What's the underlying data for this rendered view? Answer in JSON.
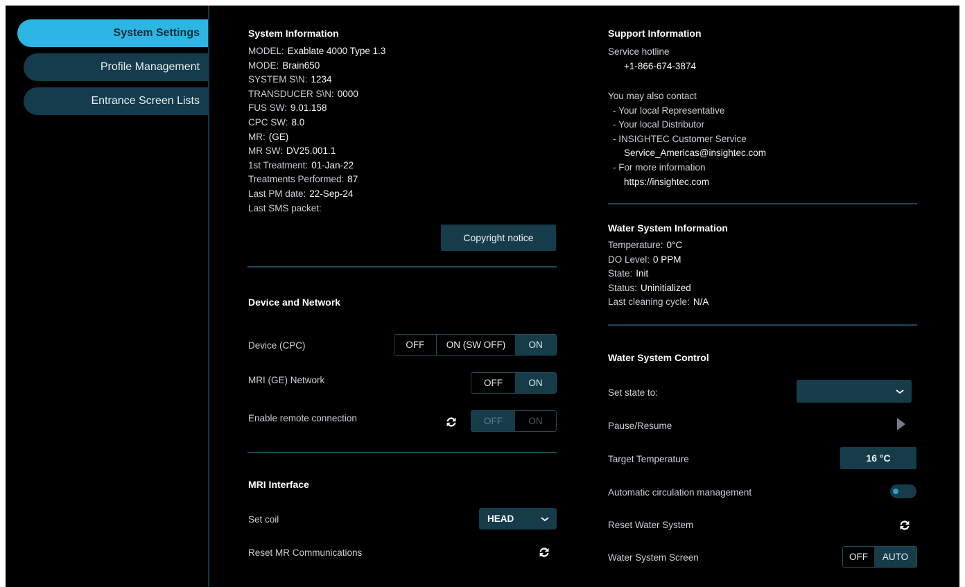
{
  "sidebar": {
    "items": [
      {
        "label": "System Settings"
      },
      {
        "label": "Profile Management"
      },
      {
        "label": "Entrance Screen Lists"
      }
    ]
  },
  "system_info": {
    "title": "System Information",
    "rows": [
      {
        "label": "MODEL:",
        "value": "Exablate 4000 Type 1.3"
      },
      {
        "label": "MODE:",
        "value": "Brain650"
      },
      {
        "label": "SYSTEM S\\N:",
        "value": "1234"
      },
      {
        "label": "TRANSDUCER S\\N:",
        "value": "0000"
      },
      {
        "label": "FUS SW:",
        "value": "9.01.158"
      },
      {
        "label": "CPC SW:",
        "value": "8.0"
      },
      {
        "label": "MR:",
        "value": "(GE)"
      },
      {
        "label": "MR SW:",
        "value": "DV25.001.1"
      },
      {
        "label": "1st Treatment:",
        "value": "01-Jan-22"
      },
      {
        "label": "Treatments Performed:",
        "value": "87"
      },
      {
        "label": "Last PM date:",
        "value": "22-Sep-24"
      },
      {
        "label": "Last SMS packet:",
        "value": ""
      }
    ],
    "copyright_button": "Copyright notice"
  },
  "device_network": {
    "title": "Device and Network",
    "device_label": "Device (CPC)",
    "device_options": [
      "OFF",
      "ON (SW OFF)",
      "ON"
    ],
    "mri_label": "MRI (GE) Network",
    "mri_options": [
      "OFF",
      "ON"
    ],
    "remote_label": "Enable remote connection",
    "remote_options": [
      "OFF",
      "ON"
    ]
  },
  "mri_interface": {
    "title": "MRI Interface",
    "coil_label": "Set coil",
    "coil_value": "HEAD",
    "reset_label": "Reset MR Communications"
  },
  "support": {
    "title": "Support Information",
    "hotline_label": "Service hotline",
    "hotline": "+1-866-674-3874",
    "contact_intro": "You may also contact",
    "contact_1": "- Your local Representative",
    "contact_2": "- Your local Distributor",
    "contact_3": "- INSIGHTEC Customer Service",
    "email": "Service_Americas@insightec.com",
    "more_info": "- For more information",
    "website": "https://insightec.com"
  },
  "water_info": {
    "title": "Water System Information",
    "rows": [
      {
        "label": "Temperature:",
        "value": "0°C"
      },
      {
        "label": "DO Level:",
        "value": "0 PPM"
      },
      {
        "label": "State:",
        "value": "Init"
      },
      {
        "label": "Status:",
        "value": "Uninitialized"
      },
      {
        "label": "Last cleaning cycle:",
        "value": "N/A"
      }
    ]
  },
  "water_control": {
    "title": "Water System Control",
    "set_state_label": "Set state to:",
    "set_state_value": "",
    "pause_label": "Pause/Resume",
    "target_temp_label": "Target Temperature",
    "target_temp_value": "16 °C",
    "auto_circ_label": "Automatic circulation management",
    "reset_label": "Reset Water System",
    "screen_label": "Water System Screen",
    "screen_options": [
      "OFF",
      "AUTO"
    ]
  },
  "colors": {
    "accent": "#2db6e3",
    "panel": "#163c4a",
    "background": "#000000"
  }
}
